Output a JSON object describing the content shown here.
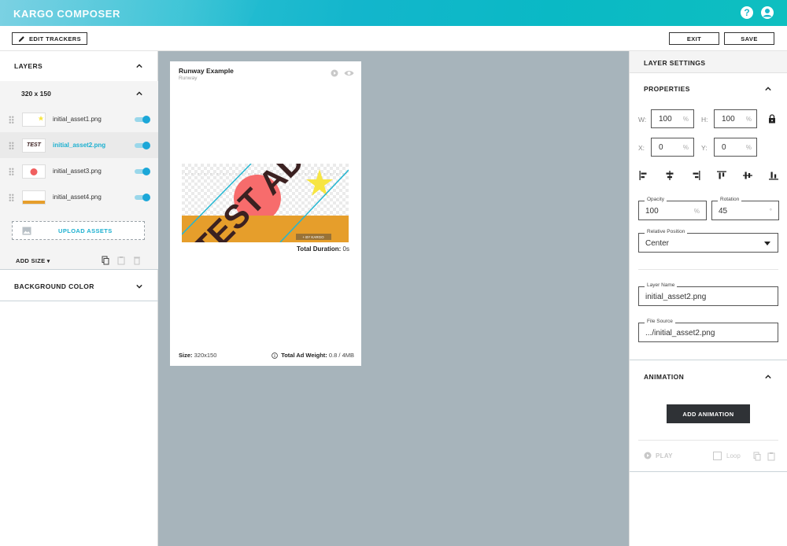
{
  "header": {
    "brand_part1": "KARGO",
    "brand_part2": "COMPOSER",
    "help_glyph": "?",
    "icons": [
      "help-icon",
      "account-icon"
    ]
  },
  "toolbar": {
    "edit_trackers": "EDIT TRACKERS",
    "exit": "EXIT",
    "save": "SAVE"
  },
  "layers": {
    "title": "LAYERS",
    "size_group": "320 x 150",
    "assets": [
      {
        "name": "initial_asset1.png",
        "selected": false,
        "visible": true
      },
      {
        "name": "initial_asset2.png",
        "selected": true,
        "visible": true
      },
      {
        "name": "initial_asset3.png",
        "selected": false,
        "visible": true
      },
      {
        "name": "initial_asset4.png",
        "selected": false,
        "visible": true
      }
    ],
    "upload_label": "UPLOAD ASSETS",
    "add_size": "ADD SIZE",
    "background_color": "BACKGROUND COLOR"
  },
  "thumb_text": "TEST AD",
  "preview": {
    "title": "Runway Example",
    "subtitle": "Runway",
    "banner_text": "TEST AD",
    "banner_tag": "+ BY KARGO",
    "total_duration_label": "Total Duration:",
    "total_duration_value": "0s",
    "size_label": "Size:",
    "size_value": "320x150",
    "weight_label": "Total Ad Weight:",
    "weight_value": "0.8 / 4MB",
    "colors": {
      "sun": "#f76c6c",
      "ground": "#e69e2b",
      "star": "#f7e542",
      "text": "#3b2121",
      "diagonal": "#23b6d2"
    }
  },
  "layer_settings": {
    "title": "LAYER SETTINGS",
    "properties": {
      "title": "PROPERTIES",
      "w_label": "W:",
      "w_value": "100",
      "w_unit": "%",
      "h_label": "H:",
      "h_value": "100",
      "h_unit": "%",
      "x_label": "X:",
      "x_value": "0",
      "x_unit": "%",
      "y_label": "Y:",
      "y_value": "0",
      "y_unit": "%",
      "opacity_label": "Opacity",
      "opacity_value": "100",
      "opacity_unit": "%",
      "rotation_label": "Rotation",
      "rotation_value": "45",
      "rotation_unit": "°",
      "relpos_label": "Relative Position",
      "relpos_value": "Center",
      "layer_name_label": "Layer Name",
      "layer_name_value": "initial_asset2.png",
      "file_source_label": "File Source",
      "file_source_value": ".../initial_asset2.png"
    },
    "animation": {
      "title": "ANIMATION",
      "add_button": "ADD ANIMATION",
      "play": "PLAY",
      "loop": "Loop"
    }
  },
  "accent_color": "#1cb0d0"
}
